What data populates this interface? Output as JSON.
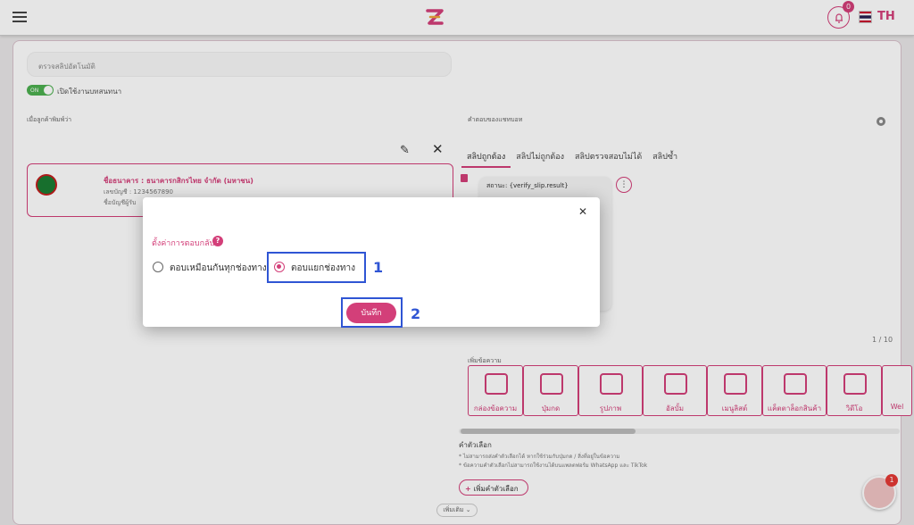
{
  "header": {
    "language": "TH",
    "notification_count": "0"
  },
  "settings": {
    "search_placeholder": "ตรวจสลิปอัตโนมัติ",
    "toggle_state": "ON",
    "toggle_label": "เปิดใช้งานบทสนทนา"
  },
  "left_panel": {
    "title": "เมื่อลูกค้าพิมพ์ว่า",
    "bank_name": "ชื่อธนาคาร : ธนาคารกสิกรไทย จำกัด (มหาชน)",
    "account_number": "เลขบัญชี : 1234567890",
    "account_holder": "ชื่อบัญชีผู้รับ"
  },
  "right_panel": {
    "title": "คำตอบของแชทบอท",
    "tabs": [
      "สลิปถูกต้อง",
      "สลิปไม่ถูกต้อง",
      "สลิปตรวจสอบไม่ได้",
      "สลิปซ้ำ"
    ],
    "slip_status": "สถานะ: {verify_slip.result}",
    "pager": "1 / 10",
    "add_label": "เพิ่มข้อความ",
    "tools": [
      "กล่องข้อความ",
      "ปุ่มกด",
      "รูปภาพ",
      "อัลบั้ม",
      "เมนูลิสต์",
      "แค็ตตาล็อกสินค้า",
      "วิดีโอ",
      "Wel"
    ],
    "options_title": "คำตัวเลือก",
    "options_note1": "* ไม่สามารถส่งคำตัวเลือกได้ หากใช้ร่วมกับปุ่มกด / สิ่งที่อยู่ในข้อความ",
    "options_note2": "* ข้อความคำตัวเลือกไม่สามารถใช้งานได้บนแพลตฟอร์ม WhatsApp และ TikTok",
    "add_option": "เพิ่มคำตัวเลือก",
    "more": "เพิ่มเติม"
  },
  "chat": {
    "badge": "1"
  },
  "modal": {
    "label": "ตั้งค่าการตอบกลับ",
    "option_same": "ตอบเหมือนกันทุกช่องทาง",
    "option_separate": "ตอบแยกช่องทาง",
    "selected": "option_separate",
    "save_label": "บันทึก",
    "step1": "1",
    "step2": "2"
  },
  "colors": {
    "accent": "#d33f79",
    "highlight": "#2f55d4"
  }
}
